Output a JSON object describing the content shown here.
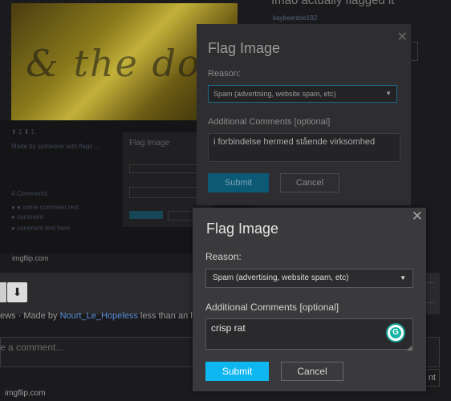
{
  "background": {
    "image_caption": "& the dollar",
    "right_title": "Imao actually flagged it",
    "right_user": "kaybeerdoe192",
    "image_site": "imgflip.com",
    "down_arrow_icon": "arrow-down-icon",
    "made_by_prefix": "ews · Made by ",
    "made_by_user": "Nourt_Le_Hopeless",
    "made_by_suffix": " less than an hour",
    "comment_placeholder": "e a comment...",
    "post_button_label": "nt",
    "footer_site": "imgflip.com",
    "lower_lines": [
      "⬆ 1 ⬇ 1",
      "Made by someone with flags ...",
      "4 Comments",
      "● ●  some comment text",
      "●  comment",
      "●  comment text here"
    ],
    "mini_dialog_title": "Flag Image"
  },
  "dialog_back": {
    "title": "Flag Image",
    "close_icon": "close-icon",
    "reason_label": "Reason:",
    "reason_value": "Spam (advertising, website spam, etc)",
    "comments_label": "Additional Comments [optional]",
    "comments_value": "i forbindelse hermed stående virksomhed",
    "submit_label": "Submit",
    "cancel_label": "Cancel"
  },
  "dialog": {
    "title": "Flag Image",
    "close_icon": "close-icon",
    "reason_label": "Reason:",
    "reason_value": "Spam (advertising, website spam, etc)",
    "comments_label": "Additional Comments [optional]",
    "comments_value": "crisp rat",
    "grammarly_icon": "grammarly-icon",
    "submit_label": "Submit",
    "cancel_label": "Cancel",
    "colors": {
      "submit_bg": "#0fb7f0",
      "dialog_bg": "#3a3a3c"
    }
  }
}
